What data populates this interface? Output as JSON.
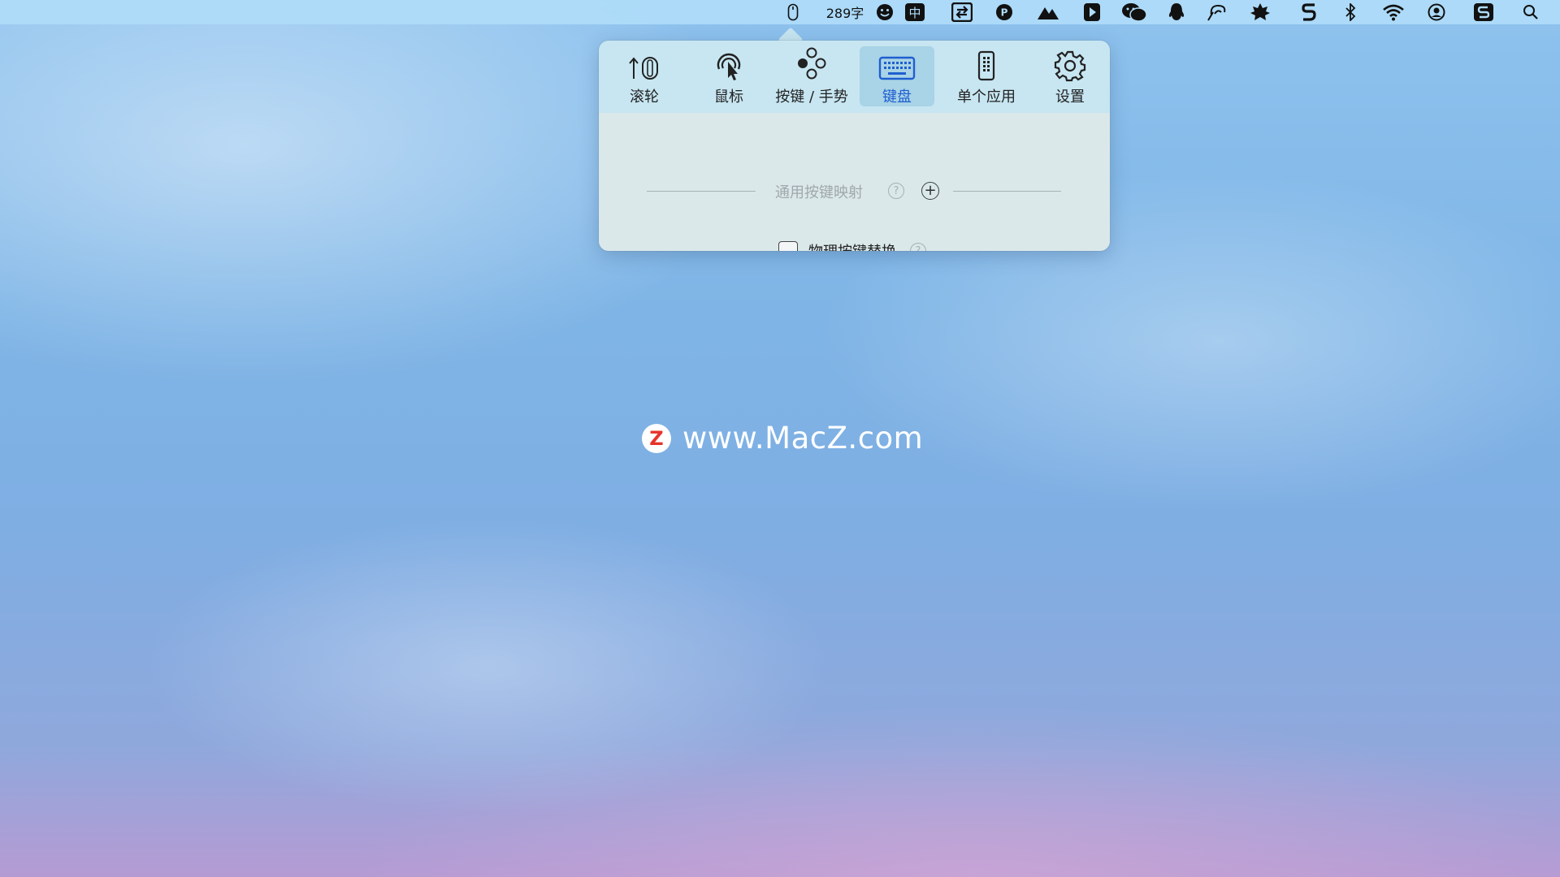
{
  "menubar": {
    "word_count": "289字",
    "input_method": "中",
    "items": [
      "mouse-icon",
      "word-count",
      "smiley-icon",
      "input-method-icon",
      "transfer-icon",
      "p-circle-icon",
      "mountains-icon",
      "play-app-icon",
      "wechat-icon",
      "qq-penguin-icon",
      "lasso-icon",
      "maple-leaf-icon",
      "s-app-icon",
      "bluetooth-icon",
      "wifi-icon",
      "user-account-icon",
      "s-square-icon",
      "spotlight-search-icon"
    ]
  },
  "popover": {
    "tabs": [
      {
        "label": "滚轮",
        "icon": "scroll-wheel-icon",
        "active": false
      },
      {
        "label": "鼠标",
        "icon": "mouse-pointer-icon",
        "active": false
      },
      {
        "label": "按键 / 手势",
        "icon": "buttons-gesture-icon",
        "active": false
      },
      {
        "label": "键盘",
        "icon": "keyboard-icon",
        "active": true
      },
      {
        "label": "单个应用",
        "icon": "single-app-icon",
        "active": false
      },
      {
        "label": "设置",
        "icon": "gear-icon",
        "active": false
      }
    ],
    "general_mapping": {
      "title": "通用按键映射",
      "help": "?",
      "add": "+"
    },
    "physical_swap": {
      "label": "物理按键替换",
      "checked": false,
      "help": "?"
    }
  },
  "watermark": {
    "logo_letter": "Z",
    "text": "www.MacZ.com"
  },
  "colors": {
    "active_tab_text": "#1f5fd0",
    "active_tab_bg": "#a9d3e6",
    "toolbar_bg": "#c7e6f1",
    "content_bg": "#dae8ea"
  }
}
